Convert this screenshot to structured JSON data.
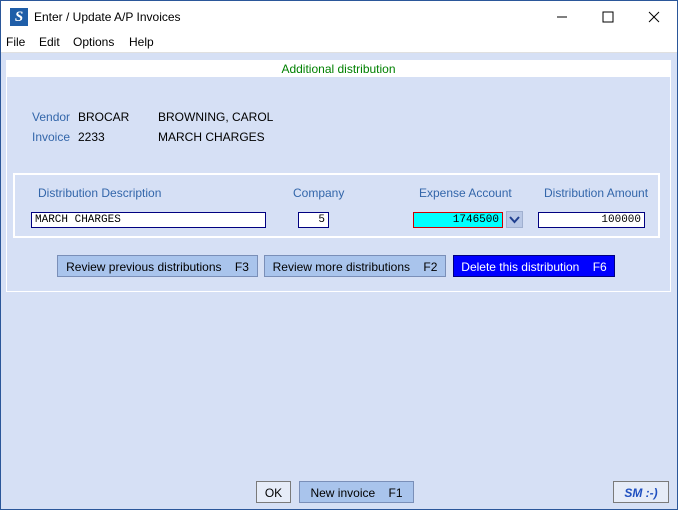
{
  "window": {
    "title": "Enter / Update A/P Invoices",
    "app_icon_letter": "S"
  },
  "menu": {
    "file": "File",
    "edit": "Edit",
    "options": "Options",
    "help": "Help"
  },
  "panel": {
    "header": "Additional distribution"
  },
  "vendor": {
    "label": "Vendor",
    "code": "BROCAR",
    "name": "BROWNING, CAROL"
  },
  "invoice": {
    "label": "Invoice",
    "number": "2233",
    "description": "MARCH CHARGES"
  },
  "distribution": {
    "headers": {
      "description": "Distribution Description",
      "company": "Company",
      "account": "Expense Account",
      "amount": "Distribution Amount"
    },
    "description_value": "MARCH CHARGES",
    "company_value": "5",
    "account_value": "1746500",
    "amount_value": "100000"
  },
  "buttons": {
    "review_previous": {
      "label": "Review previous distributions",
      "key": "F3"
    },
    "review_more": {
      "label": "Review more distributions",
      "key": "F2"
    },
    "delete": {
      "label": "Delete this distribution",
      "key": "F6"
    },
    "ok": "OK",
    "new_invoice": {
      "label": "New invoice",
      "key": "F1"
    },
    "sm_logo": "SM :-)"
  },
  "colors": {
    "accent_blue": "#0000ff",
    "account_highlight": "#00ffff",
    "panel_bg": "#d6e0f5",
    "label_blue": "#3366aa"
  }
}
